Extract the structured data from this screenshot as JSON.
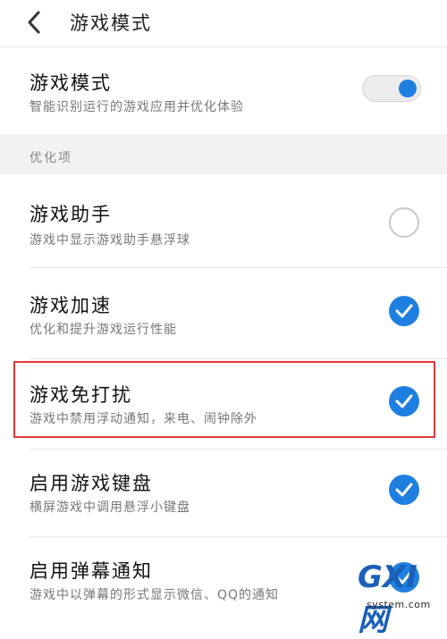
{
  "header": {
    "title": "游戏模式"
  },
  "game_mode": {
    "title": "游戏模式",
    "subtitle": "智能识别运行的游戏应用并优化体验",
    "enabled": true
  },
  "section_label": "优化项",
  "items": [
    {
      "title": "游戏助手",
      "subtitle": "游戏中显示游戏助手悬浮球",
      "checked": false
    },
    {
      "title": "游戏加速",
      "subtitle": "优化和提升游戏运行性能",
      "checked": true
    },
    {
      "title": "游戏免打扰",
      "subtitle": "游戏中禁用浮动通知，来电、闹钟除外",
      "checked": true
    },
    {
      "title": "启用游戏键盘",
      "subtitle": "横屏游戏中调用悬浮小键盘",
      "checked": true
    },
    {
      "title": "启用弹幕通知",
      "subtitle": "游戏中以弹幕的形式显示微信、QQ的通知",
      "checked": true
    }
  ],
  "watermark": {
    "logo": "GXI网",
    "site": "system.com"
  },
  "colors": {
    "accent": "#1f7fe0",
    "highlight": "#e03a3a"
  }
}
